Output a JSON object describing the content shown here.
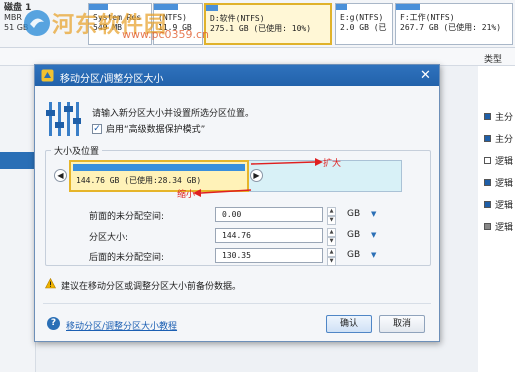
{
  "background": {
    "disk": {
      "label": "磁盘 1",
      "line2": "MBR",
      "line3": "51 GB"
    },
    "partitions": [
      {
        "name": "System Res",
        "size": "549 MB",
        "selected": false,
        "fill_fraction": 0.3
      },
      {
        "name": "(NTFS)",
        "size": "11.9 GB",
        "selected": false,
        "fill_fraction": 0.5
      },
      {
        "name": "D:软件(NTFS)",
        "size": "275.1 GB (已使用: 10%)",
        "selected": true,
        "fill_fraction": 0.1
      },
      {
        "name": "E:g(NTFS)",
        "size": "2.0 GB (已",
        "selected": false,
        "fill_fraction": 0.2
      },
      {
        "name": "F:工作(NTFS)",
        "size": "267.7 GB (已使用: 21%)",
        "selected": false,
        "fill_fraction": 0.21
      }
    ],
    "watermark": {
      "text": "河东软件园",
      "url": "www.pc0359.cn"
    },
    "type_column_header": "类型",
    "type_rows": [
      {
        "label": "主分",
        "color": "#1f5fa8"
      },
      {
        "label": "主分",
        "color": "#1f5fa8"
      },
      {
        "label": "逻辑",
        "color": "#ffffff"
      },
      {
        "label": "逻辑",
        "color": "#1f5fa8"
      },
      {
        "label": "逻辑",
        "color": "#1f5fa8"
      },
      {
        "label": "逻辑",
        "color": "#888888"
      }
    ]
  },
  "dialog": {
    "title": "移动分区/调整分区大小",
    "close_glyph": "✕",
    "instruction": "请输入新分区大小并设置所选分区位置。",
    "checkbox": {
      "label": "启用“高级数据保护模式”",
      "checked": true
    },
    "group_title": "大小及位置",
    "partition_bar": {
      "text": "144.76 GB (已使用:28.34 GB)",
      "used_fraction": 0.196
    },
    "annotations": {
      "expand": "扩大",
      "shrink": "缩小"
    },
    "fields": [
      {
        "label": "前面的未分配空间:",
        "value": "0.00",
        "unit": "GB"
      },
      {
        "label": "分区大小:",
        "value": "144.76",
        "unit": "GB"
      },
      {
        "label": "后面的未分配空间:",
        "value": "130.35",
        "unit": "GB"
      }
    ],
    "warning": "建议在移动分区或调整分区大小前备份数据。",
    "help_link": "移动分区/调整分区大小教程",
    "ok_label": "确认",
    "cancel_label": "取消"
  }
}
